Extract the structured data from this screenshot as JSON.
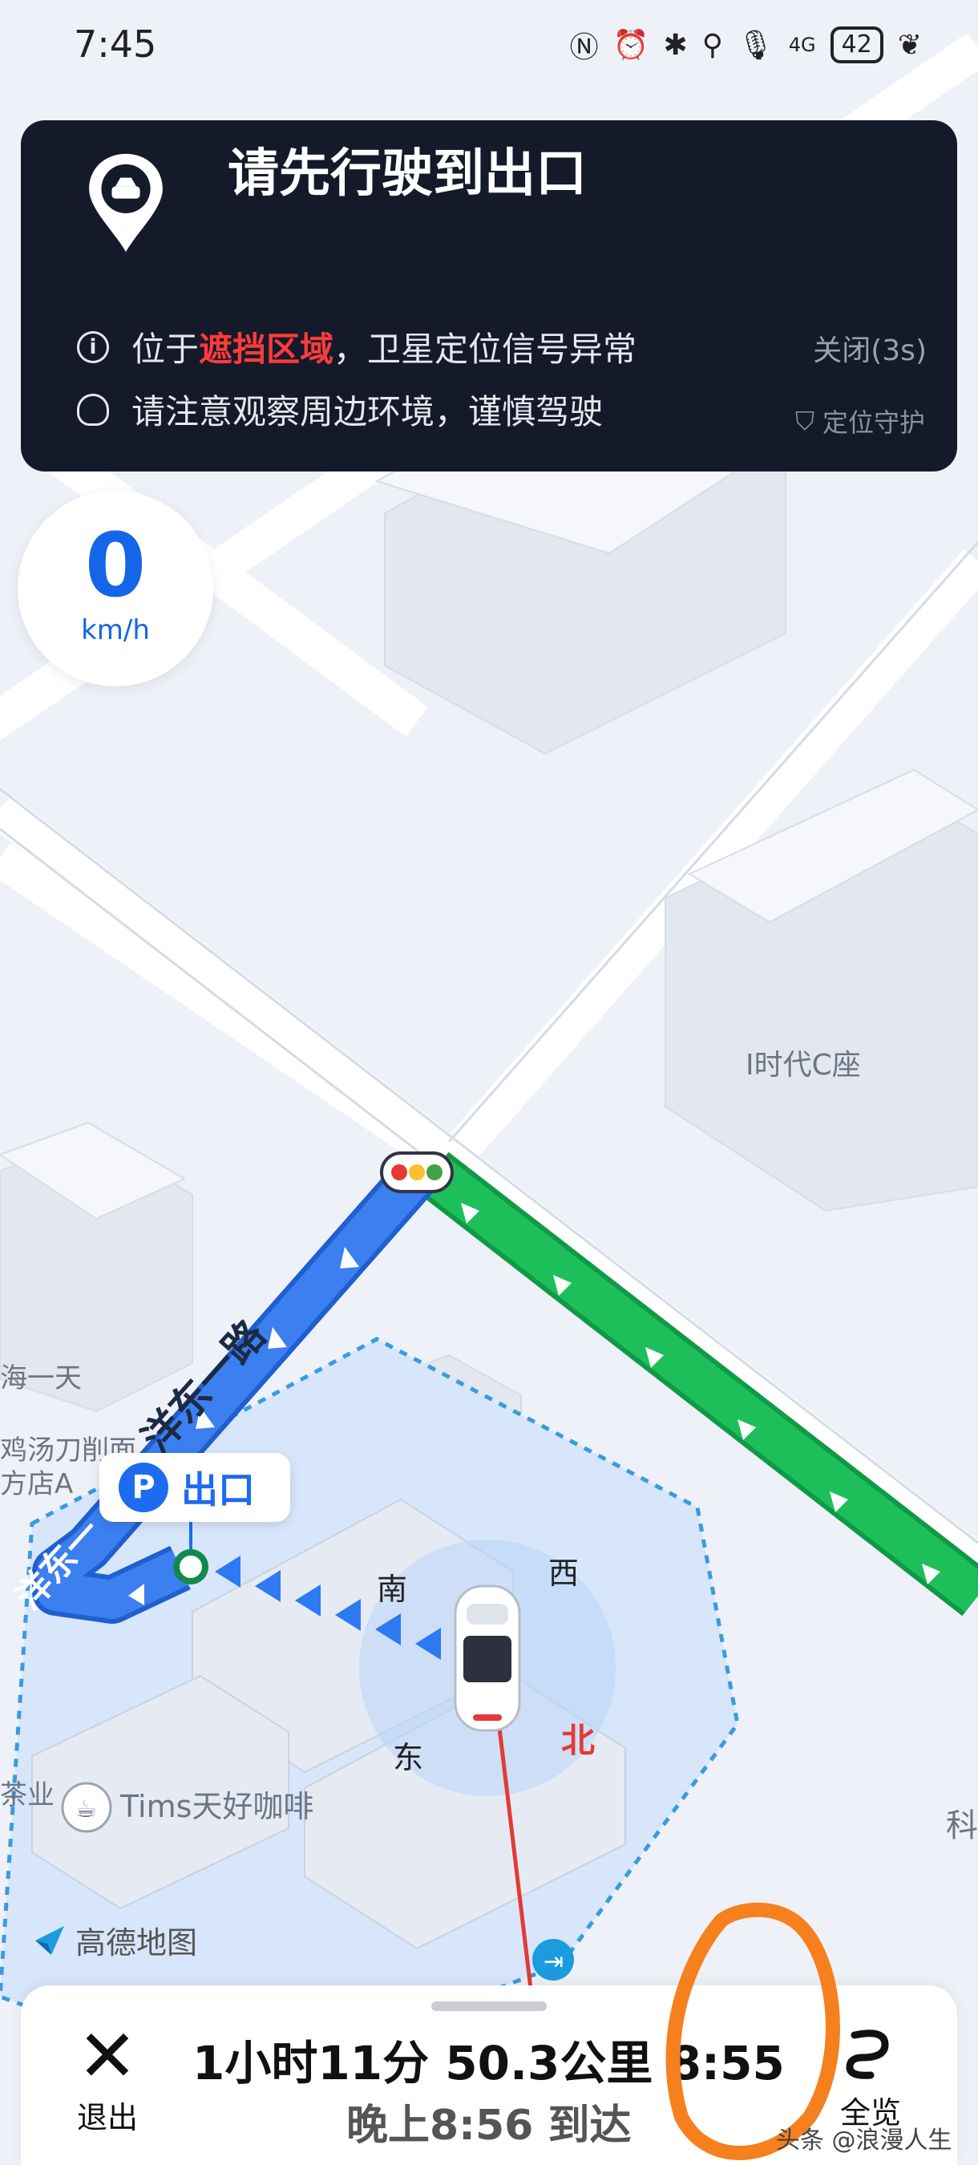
{
  "status_bar": {
    "time": "7:45",
    "battery": "42",
    "network": "4G"
  },
  "banner": {
    "title": "请先行驶到出口",
    "notice1_pre": "位于",
    "notice1_highlight": "遮挡区域",
    "notice1_post": "，卫星定位信号异常",
    "notice2": "请注意观察周边环境，谨慎驾驶",
    "close_label": "关闭(3s)",
    "guard_label": "定位守护"
  },
  "speed": {
    "value": "0",
    "unit": "km/h"
  },
  "map": {
    "poi_building": "I时代C座",
    "road_name": "洋东一路",
    "road_name_partial": "洋东一",
    "exit_label": "出口",
    "exit_badge": "P",
    "poi_left1": "海一天",
    "poi_left2": "鸡汤刀削面",
    "poi_left3": "方店A",
    "poi_left4": "茶业",
    "poi_coffee": "Tims天好咖啡",
    "compass_n": "北",
    "compass_s": "南",
    "compass_e": "东",
    "compass_w": "西",
    "edge_text": "科",
    "brand": "高德地图",
    "colors": {
      "route_blue": "#3b7ff0",
      "route_green": "#1dbf5a",
      "compass_red": "#e53935"
    }
  },
  "bottom_bar": {
    "exit_label": "退出",
    "trip_info": "1小时11分  50.3公里  8:55",
    "arrival": "晚上8:56 到达",
    "overview_label": "全览"
  },
  "watermark": "头条 @浪漫人生"
}
